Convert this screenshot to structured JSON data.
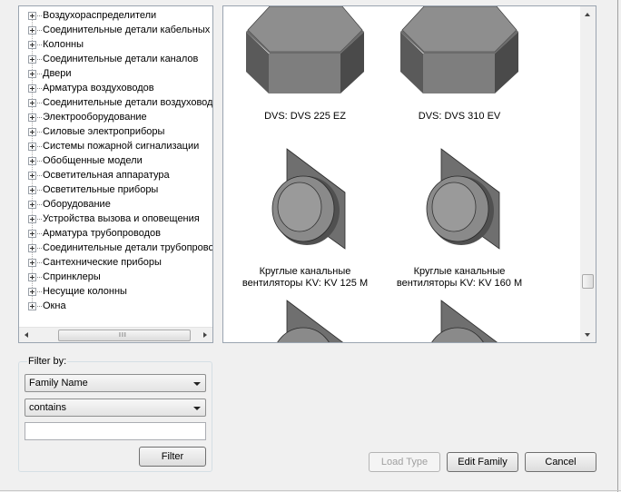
{
  "tree": {
    "items": [
      {
        "label": "Воздухораспределители"
      },
      {
        "label": "Соединительные детали кабельных лотков"
      },
      {
        "label": "Колонны"
      },
      {
        "label": "Соединительные детали каналов"
      },
      {
        "label": "Двери"
      },
      {
        "label": "Арматура воздуховодов"
      },
      {
        "label": "Соединительные детали воздуховодов"
      },
      {
        "label": "Электрооборудование"
      },
      {
        "label": "Силовые электроприборы"
      },
      {
        "label": "Системы пожарной сигнализации"
      },
      {
        "label": "Обобщенные модели"
      },
      {
        "label": "Осветительная аппаратура"
      },
      {
        "label": "Осветительные приборы"
      },
      {
        "label": "Оборудование"
      },
      {
        "label": "Устройства вызова и оповещения"
      },
      {
        "label": "Арматура трубопроводов"
      },
      {
        "label": "Соединительные детали трубопроводов"
      },
      {
        "label": "Сантехнические приборы"
      },
      {
        "label": "Спринклеры"
      },
      {
        "label": "Несущие колонны"
      },
      {
        "label": "Окна"
      }
    ],
    "scroll_grip": "III"
  },
  "preview": {
    "tiles": [
      {
        "label": "DVS: DVS 225 EZ",
        "icon": "roof-fan-icon"
      },
      {
        "label": "DVS: DVS 310 EV",
        "icon": "roof-fan-icon"
      },
      {
        "label": "Круглые канальные вентиляторы KV: KV 125 M",
        "icon": "duct-fan-icon"
      },
      {
        "label": "Круглые канальные вентиляторы KV: KV 160 M",
        "icon": "duct-fan-icon"
      }
    ]
  },
  "filter": {
    "legend": "Filter by:",
    "field_selected": "Family Name",
    "operator_selected": "contains",
    "text_value": "",
    "filter_button": "Filter"
  },
  "buttons": {
    "load_type": "Load Type",
    "edit_family": "Edit Family",
    "cancel": "Cancel"
  }
}
